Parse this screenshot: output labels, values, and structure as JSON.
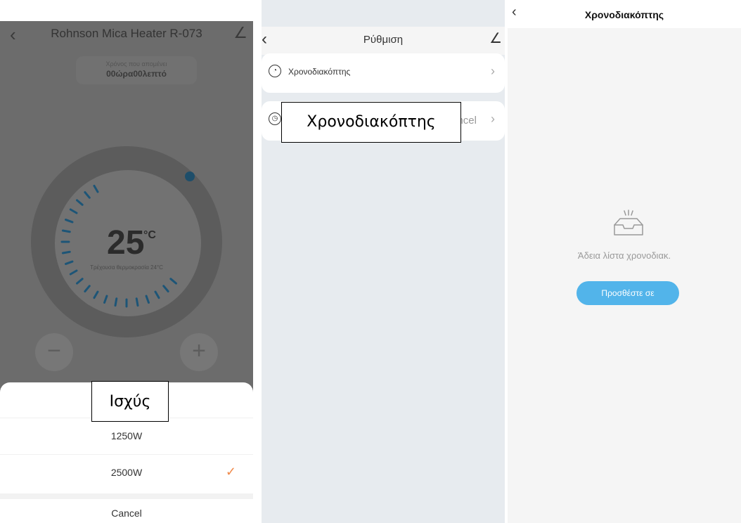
{
  "panel1": {
    "header": {
      "title": "Rohnson Mica Heater R-073"
    },
    "timer": {
      "label": "Χρόνος που απομένει",
      "value": "00ώρα00λεπτό"
    },
    "dial": {
      "temperature": "25",
      "unit": "°C",
      "current_temp_label": "Τρέχουσα θερμοκρασία 24°C"
    },
    "buttons": {
      "minus": "−",
      "plus": "+"
    },
    "sheet": {
      "title": "Ισχύς",
      "options": [
        {
          "label": "1250W",
          "selected": false
        },
        {
          "label": "2500W",
          "selected": true
        }
      ],
      "cancel": "Cancel"
    }
  },
  "panel2": {
    "header": {
      "title": "Ρύθμιση"
    },
    "items": [
      {
        "label": "Χρονοδιακόπτης"
      },
      {
        "label": "Χρονοδιακόπτης",
        "trailing": "ncel"
      }
    ]
  },
  "panel3": {
    "header": {
      "title": "Χρονοδιακόπτης"
    },
    "empty_text": "Άδεια λίστα χρονοδιακ.",
    "add_button": "Προσθέστε σε"
  },
  "colors": {
    "accent_blue": "#52b4ea",
    "check_orange": "#f08a4b",
    "dial_dot": "#1e4e6a"
  }
}
